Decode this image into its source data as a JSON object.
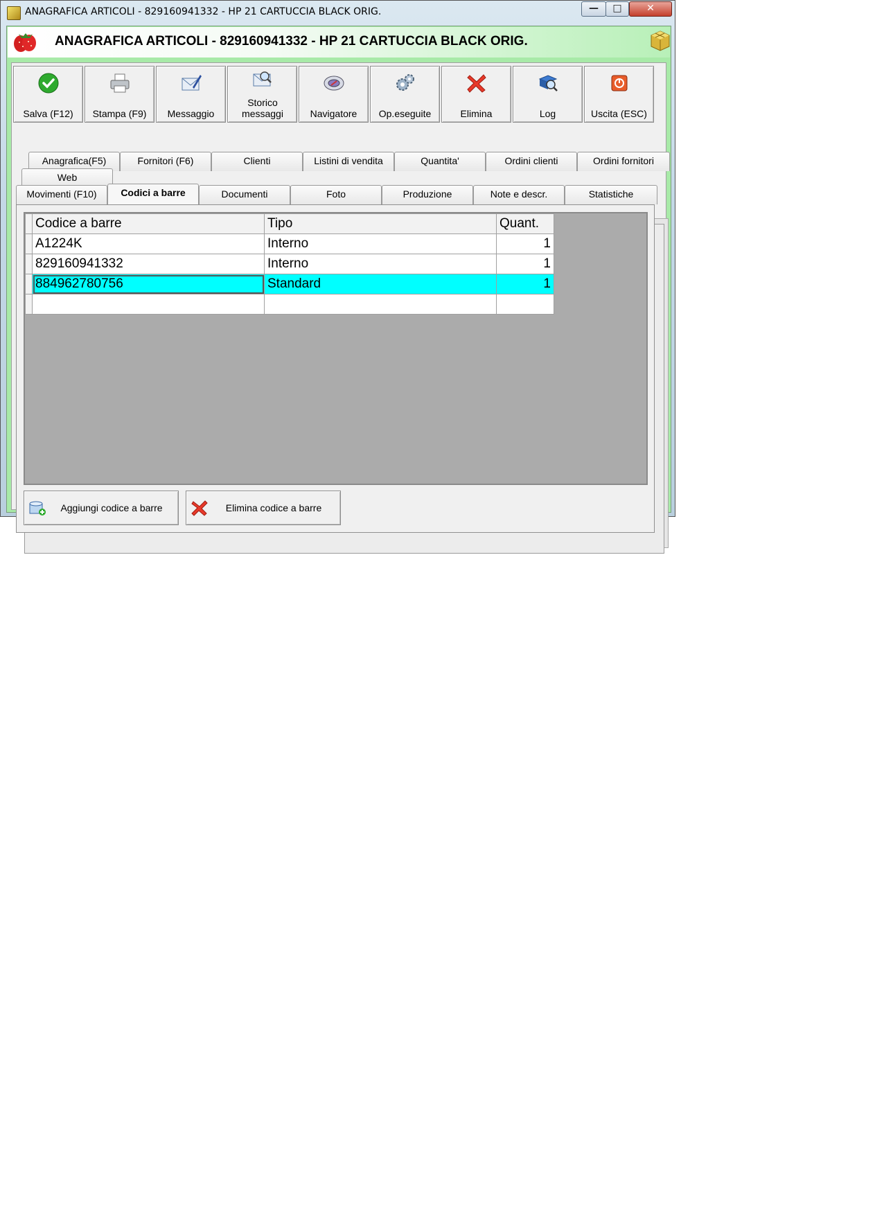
{
  "window": {
    "title": "ANAGRAFICA ARTICOLI - 829160941332 - HP 21 CARTUCCIA BLACK ORIG.",
    "minimize_glyph": "—",
    "maximize_glyph": "□",
    "close_glyph": "✕"
  },
  "header": {
    "title": "ANAGRAFICA ARTICOLI - 829160941332 - HP 21 CARTUCCIA BLACK ORIG."
  },
  "toolbar": {
    "buttons": [
      {
        "label": "Salva (F12)",
        "icon": "check-icon"
      },
      {
        "label": "Stampa (F9)",
        "icon": "printer-icon"
      },
      {
        "label": "Messaggio",
        "icon": "envelope-pen-icon"
      },
      {
        "label": "Storico messaggi",
        "icon": "envelope-search-icon"
      },
      {
        "label": "Navigatore",
        "icon": "compass-icon"
      },
      {
        "label": "Op.eseguite",
        "icon": "gears-icon"
      },
      {
        "label": "Elimina",
        "icon": "red-x-icon"
      },
      {
        "label": "Log",
        "icon": "book-search-icon"
      },
      {
        "label": "Uscita (ESC)",
        "icon": "exit-icon"
      }
    ]
  },
  "tabs": {
    "row1": [
      "Anagrafica(F5)",
      "Fornitori (F6)",
      "Clienti",
      "Listini di vendita",
      "Quantita'",
      "Ordini clienti",
      "Ordini fornitori"
    ],
    "row2": [
      "Web"
    ],
    "row3": [
      "Movimenti (F10)",
      "Codici a barre",
      "Documenti",
      "Foto",
      "Produzione",
      "Note e descr.",
      "Statistiche"
    ],
    "active": "Codici a barre"
  },
  "grid": {
    "columns": [
      "Codice a barre",
      "Tipo",
      "Quant."
    ],
    "rows": [
      {
        "code": "A1224K",
        "type": "Interno",
        "qty": "1"
      },
      {
        "code": "829160941332",
        "type": "Interno",
        "qty": "1"
      },
      {
        "code": "884962780756",
        "type": "Standard",
        "qty": "1"
      },
      {
        "code": "",
        "type": "",
        "qty": ""
      }
    ],
    "selected_row": 2
  },
  "actions": {
    "add_label": "Aggiungi codice a barre",
    "delete_label": "Elimina codice a barre"
  },
  "colors": {
    "selected_row": "#00ffff",
    "header_gradient_end": "#b8f0b8",
    "grid_background": "#ababab"
  }
}
